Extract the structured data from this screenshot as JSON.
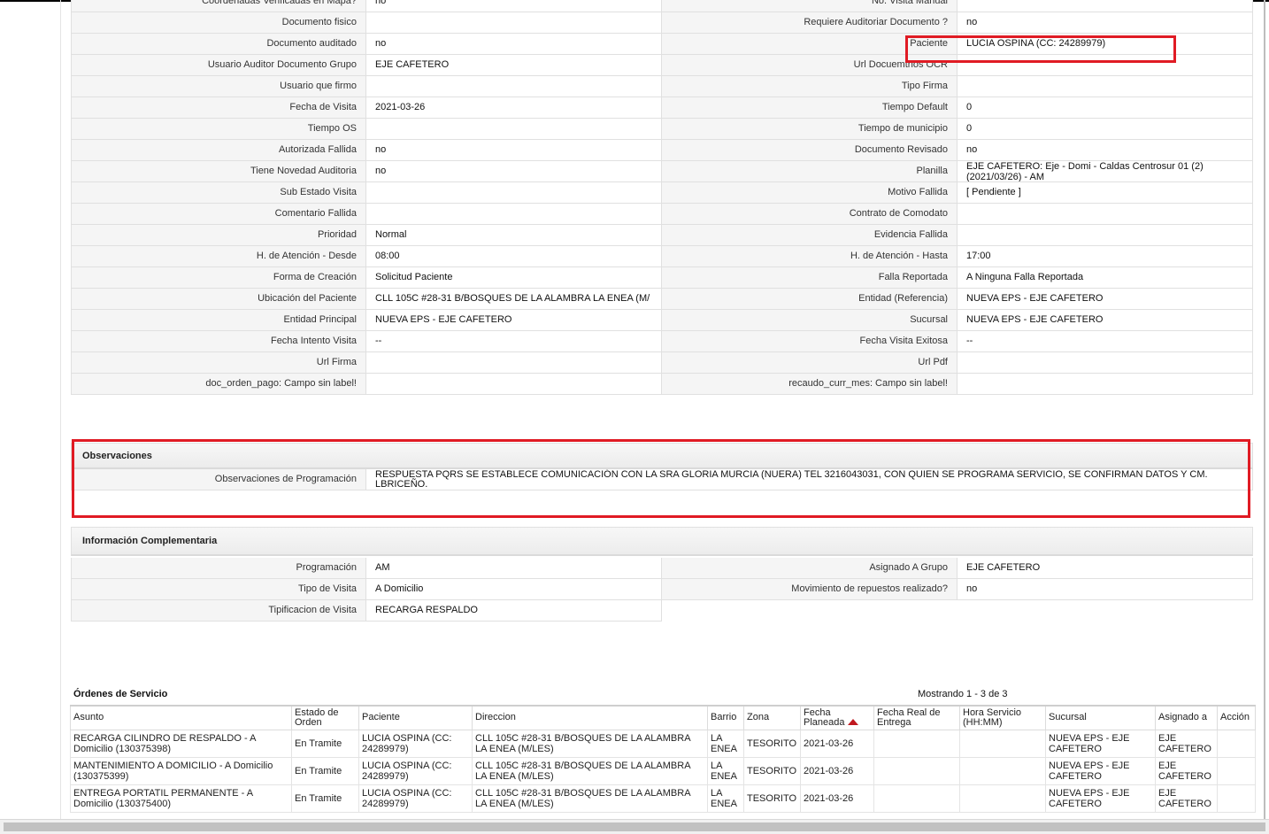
{
  "detail_rows": [
    [
      "Coordenadas Verificadas en Mapa?",
      "no",
      "No. Visita Manual",
      ""
    ],
    [
      "Documento fisico",
      "",
      "Requiere Auditoriar Documento ?",
      "no"
    ],
    [
      "Documento auditado",
      "no",
      "Paciente",
      "LUCIA OSPINA (CC: 24289979)"
    ],
    [
      "Usuario Auditor Documento Grupo",
      "EJE CAFETERO",
      "Url Docuemtnos OCR",
      ""
    ],
    [
      "Usuario que firmo",
      "",
      "Tipo Firma",
      ""
    ],
    [
      "Fecha de Visita",
      "2021-03-26",
      "Tiempo Default",
      "0"
    ],
    [
      "Tiempo OS",
      "",
      "Tiempo de municipio",
      "0"
    ],
    [
      "Autorizada Fallida",
      "no",
      "Documento Revisado",
      "no"
    ],
    [
      "Tiene Novedad Auditoria",
      "no",
      "Planilla",
      "EJE CAFETERO: Eje - Domi - Caldas Centrosur 01 (2) (2021/03/26) - AM"
    ],
    [
      "Sub Estado Visita",
      "",
      "Motivo Fallida",
      "[ Pendiente ]"
    ],
    [
      "Comentario Fallida",
      "",
      "Contrato de Comodato",
      ""
    ],
    [
      "Prioridad",
      "Normal",
      "Evidencia Fallida",
      ""
    ],
    [
      "H. de Atención - Desde",
      "08:00",
      "H. de Atención - Hasta",
      "17:00"
    ],
    [
      "Forma de Creación",
      "Solicitud Paciente",
      "Falla Reportada",
      "A Ninguna Falla Reportada"
    ],
    [
      "Ubicación del Paciente",
      "CLL 105C #28-31 B/BOSQUES DE LA ALAMBRA LA ENEA (M/",
      "Entidad (Referencia)",
      "NUEVA EPS - EJE CAFETERO"
    ],
    [
      "Entidad Principal",
      "NUEVA EPS - EJE CAFETERO",
      "Sucursal",
      "NUEVA EPS - EJE CAFETERO"
    ],
    [
      "Fecha Intento Visita",
      "--",
      "Fecha Visita Exitosa",
      "--"
    ],
    [
      "Url Firma",
      "",
      "Url Pdf",
      ""
    ],
    [
      "doc_orden_pago: Campo sin label!",
      "",
      "recaudo_curr_mes: Campo sin label!",
      ""
    ]
  ],
  "observaciones": {
    "title": "Observaciones",
    "label": "Observaciones de Programación",
    "value": "  RESPUESTA PQRS SE ESTABLECE COMUNICACIÓN CON LA SRA GLORIA MURCIA (NUERA) TEL 3216043031, CON QUIEN SE PROGRAMA SERVICIO, SE CONFIRMAN DATOS Y CM. LBRICEÑO."
  },
  "complementaria": {
    "title": "Información Complementaria",
    "rows": [
      [
        "Programación",
        "AM",
        "Asignado A Grupo",
        "EJE CAFETERO"
      ],
      [
        "Tipo de Visita",
        "A Domicilio",
        "Movimiento de repuestos realizado?",
        "no"
      ],
      [
        "Tipificacion de Visita",
        "RECARGA RESPALDO",
        null,
        null
      ]
    ]
  },
  "orders": {
    "title": "Órdenes de Servicio",
    "count_text": "Mostrando 1 - 3 de 3",
    "columns": [
      "Asunto",
      "Estado de Orden",
      "Paciente",
      "Direccion",
      "Barrio",
      "Zona",
      "Fecha Planeada",
      "Fecha Real de Entrega",
      "Hora Servicio (HH:MM)",
      "Sucursal",
      "Asignado a",
      "Acción"
    ],
    "sorted_column": "Fecha Planeada",
    "rows": [
      [
        "RECARGA CILINDRO DE RESPALDO - A Domicilio (130375398)",
        "En Tramite",
        "LUCIA OSPINA (CC: 24289979)",
        "CLL 105C #28-31 B/BOSQUES DE LA ALAMBRA LA ENEA (M/LES)",
        "LA ENEA",
        "TESORITO",
        "2021-03-26",
        "",
        "",
        "NUEVA EPS - EJE CAFETERO",
        "EJE CAFETERO",
        ""
      ],
      [
        "MANTENIMIENTO A DOMICILIO - A Domicilio (130375399)",
        "En Tramite",
        "LUCIA OSPINA (CC: 24289979)",
        "CLL 105C #28-31 B/BOSQUES DE LA ALAMBRA LA ENEA (M/LES)",
        "LA ENEA",
        "TESORITO",
        "2021-03-26",
        "",
        "",
        "NUEVA EPS - EJE CAFETERO",
        "EJE CAFETERO",
        ""
      ],
      [
        "ENTREGA PORTATIL PERMANENTE - A Domicilio (130375400)",
        "En Tramite",
        "LUCIA OSPINA (CC: 24289979)",
        "CLL 105C #28-31 B/BOSQUES DE LA ALAMBRA LA ENEA (M/LES)",
        "LA ENEA",
        "TESORITO",
        "2021-03-26",
        "",
        "",
        "NUEVA EPS - EJE CAFETERO",
        "EJE CAFETERO",
        ""
      ]
    ]
  },
  "highlight_color": "#e01b24"
}
